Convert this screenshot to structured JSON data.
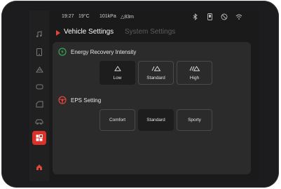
{
  "status_bar": {
    "time": "19:27",
    "temperature": "19°C",
    "pressure": "101kPa",
    "altitude": "△83m",
    "icons": [
      "bluetooth-icon",
      "phone-icon",
      "no-signal-icon",
      "wifi-icon"
    ]
  },
  "sidebar": {
    "items": [
      {
        "name": "music-icon",
        "glyph": "♫"
      },
      {
        "name": "phone-icon",
        "glyph": "▯"
      },
      {
        "name": "navigation-icon",
        "glyph": "⛰"
      },
      {
        "name": "car-icon",
        "glyph": "▢"
      },
      {
        "name": "apps-icon",
        "glyph": "⬚"
      },
      {
        "name": "vehicle-icon",
        "glyph": "🚗"
      },
      {
        "name": "settings-icon",
        "glyph": "▦"
      },
      {
        "name": "home-icon",
        "glyph": "⌂"
      }
    ],
    "active_index": 6
  },
  "tabs": {
    "active": "Vehicle Settings",
    "inactive": "System Settings"
  },
  "energy_recovery": {
    "title": "Energy Recovery Intensity",
    "options": [
      {
        "glyph": "/△",
        "label": "Low"
      },
      {
        "glyph": "/△",
        "label": "Standard"
      },
      {
        "glyph": "//△",
        "label": "High"
      }
    ],
    "selected_index": 0
  },
  "eps": {
    "title": "EPS Setting",
    "options": [
      {
        "label": "Comfort"
      },
      {
        "label": "Standard"
      },
      {
        "label": "Sporty"
      }
    ],
    "selected_index": 1
  },
  "colors": {
    "accent": "#e0463e",
    "energy_icon": "#3aa657",
    "background": "#1a1a1a",
    "panel": "#2b2b2b"
  }
}
